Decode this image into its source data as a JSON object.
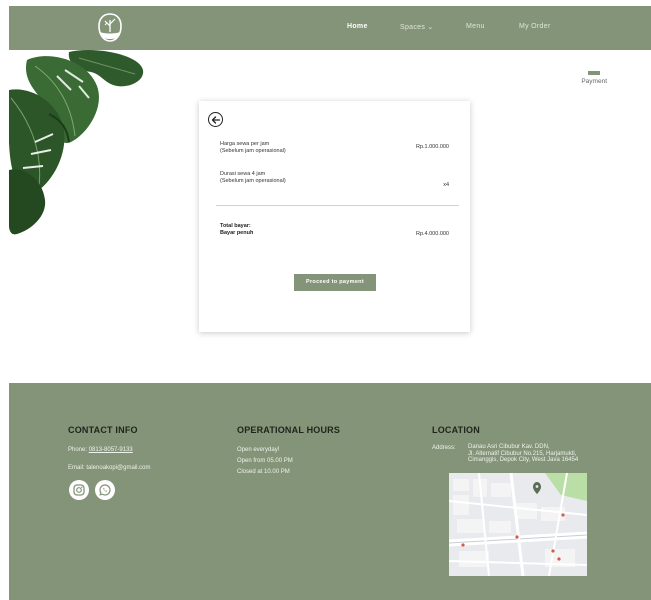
{
  "nav": {
    "home": "Home",
    "spaces": "Spaces ⌄",
    "menu": "Menu",
    "order": "My Order"
  },
  "step": {
    "label": "Payment"
  },
  "card": {
    "rows": [
      {
        "label_line1": "Harga sewa per jam",
        "label_line2": "(Sebelum jam operasional)",
        "value": "Rp.1.000.000"
      },
      {
        "label_line1": "Durasi sewa 4 jam",
        "label_line2": "(Sebelum jam operasional)",
        "value": "x4"
      }
    ],
    "total_line1": "Total bayar:",
    "total_line2": "Bayar penuh",
    "total_value": "Rp.4.000.000",
    "button": "Proceed to payment"
  },
  "footer": {
    "contact": {
      "title": "CONTACT INFO",
      "phone_label": "Phone:",
      "phone": "0813-8057-9133",
      "email_label": "Email:",
      "email": "talenoakopi@gmail.com"
    },
    "hours": {
      "title": "OPERATIONAL HOURS",
      "line1": "Open everyday!",
      "line2": "Open from 05.00 PM",
      "line3": "Closed at 10.00 PM"
    },
    "location": {
      "title": "LOCATION",
      "address_label": "Address:",
      "line1": "Danau Asri Cibubur Kav. DDN,",
      "line2": "Jl. Alternatif Cibubur No.215, Harjamukti,",
      "line3": "Cimanggis, Depok City, West Java 16454"
    }
  },
  "colors": {
    "primary": "#849479",
    "text_dark": "#1f241c"
  },
  "icons": [
    "tree-logo-icon",
    "back-arrow-icon",
    "instagram-icon",
    "whatsapp-icon"
  ]
}
